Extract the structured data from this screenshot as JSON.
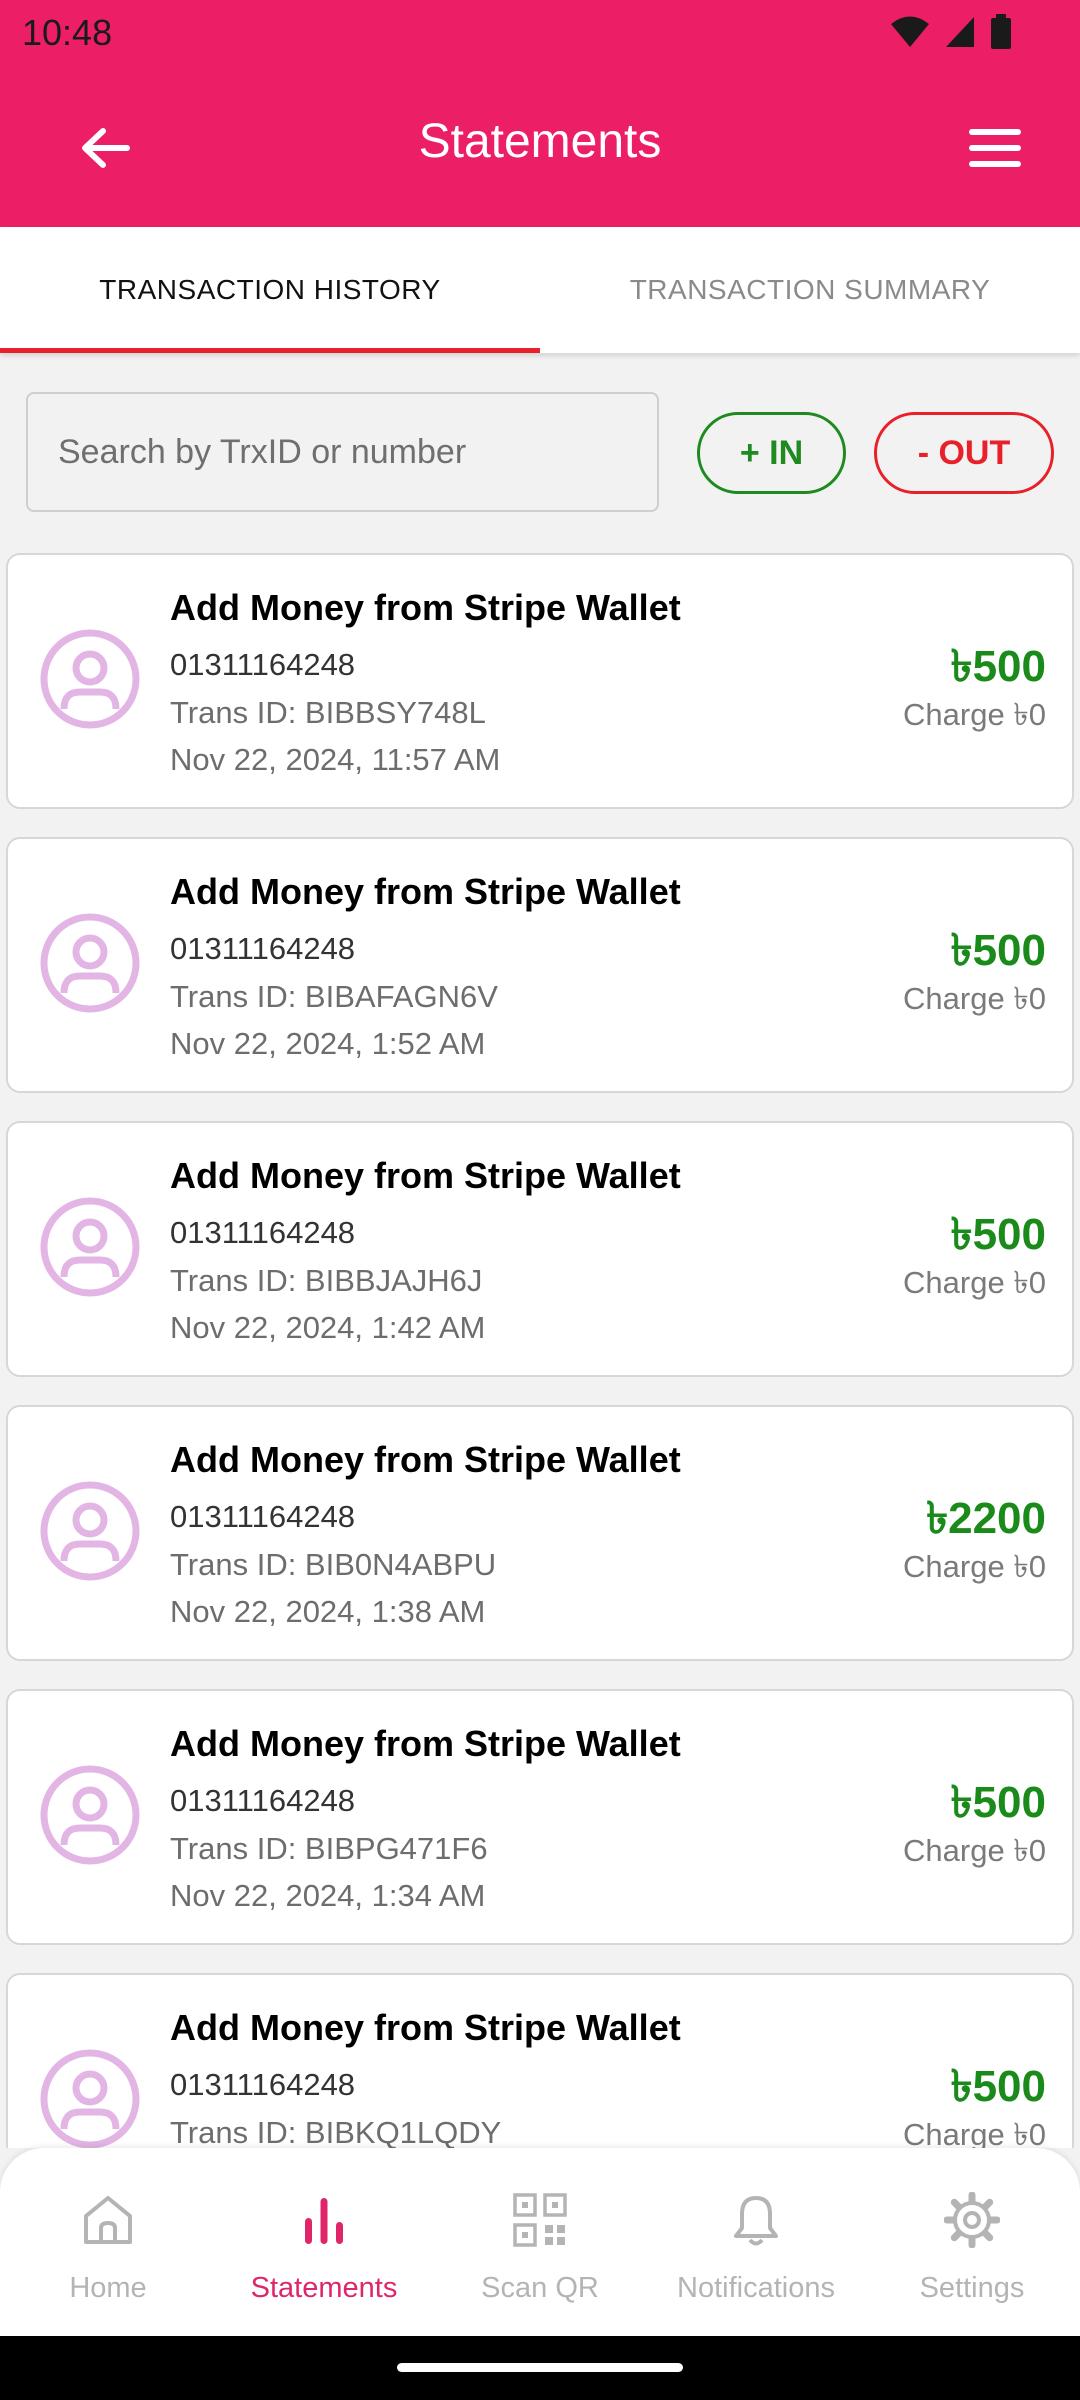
{
  "status_bar": {
    "time": "10:48"
  },
  "header": {
    "title": "Statements"
  },
  "tabs": [
    {
      "label": "TRANSACTION HISTORY",
      "active": true
    },
    {
      "label": "TRANSACTION SUMMARY",
      "active": false
    }
  ],
  "search": {
    "placeholder": "Search by TrxID or number"
  },
  "filters": {
    "in_label": "+ IN",
    "out_label": "- OUT"
  },
  "colors": {
    "brand": "#ec1e66",
    "accent_red": "#e8202a",
    "amount_green": "#1a8a1a",
    "avatar_purple": "#e2b5e4"
  },
  "transactions": [
    {
      "title": "Add Money from Stripe Wallet",
      "number": "01311164248",
      "trx_id": "Trans ID: BIBBSY748L",
      "date": "Nov 22, 2024, 11:57 AM",
      "amount": "৳500",
      "charge": "Charge ৳0"
    },
    {
      "title": "Add Money from Stripe Wallet",
      "number": "01311164248",
      "trx_id": "Trans ID: BIBAFAGN6V",
      "date": "Nov 22, 2024, 1:52 AM",
      "amount": "৳500",
      "charge": "Charge ৳0"
    },
    {
      "title": "Add Money from Stripe Wallet",
      "number": "01311164248",
      "trx_id": "Trans ID: BIBBJAJH6J",
      "date": "Nov 22, 2024, 1:42 AM",
      "amount": "৳500",
      "charge": "Charge ৳0"
    },
    {
      "title": "Add Money from Stripe Wallet",
      "number": "01311164248",
      "trx_id": "Trans ID: BIB0N4ABPU",
      "date": "Nov 22, 2024, 1:38 AM",
      "amount": "৳2200",
      "charge": "Charge ৳0"
    },
    {
      "title": "Add Money from Stripe Wallet",
      "number": "01311164248",
      "trx_id": "Trans ID: BIBPG471F6",
      "date": "Nov 22, 2024, 1:34 AM",
      "amount": "৳500",
      "charge": "Charge ৳0"
    },
    {
      "title": "Add Money from Stripe Wallet",
      "number": "01311164248",
      "trx_id": "Trans ID: BIBKQ1LQDY",
      "date": "",
      "amount": "৳500",
      "charge": "Charge ৳0"
    }
  ],
  "bottom_nav": [
    {
      "label": "Home",
      "icon": "home-icon",
      "active": false
    },
    {
      "label": "Statements",
      "icon": "bar-chart-icon",
      "active": true
    },
    {
      "label": "Scan QR",
      "icon": "qr-code-icon",
      "active": false
    },
    {
      "label": "Notifications",
      "icon": "bell-icon",
      "active": false
    },
    {
      "label": "Settings",
      "icon": "gear-icon",
      "active": false
    }
  ]
}
